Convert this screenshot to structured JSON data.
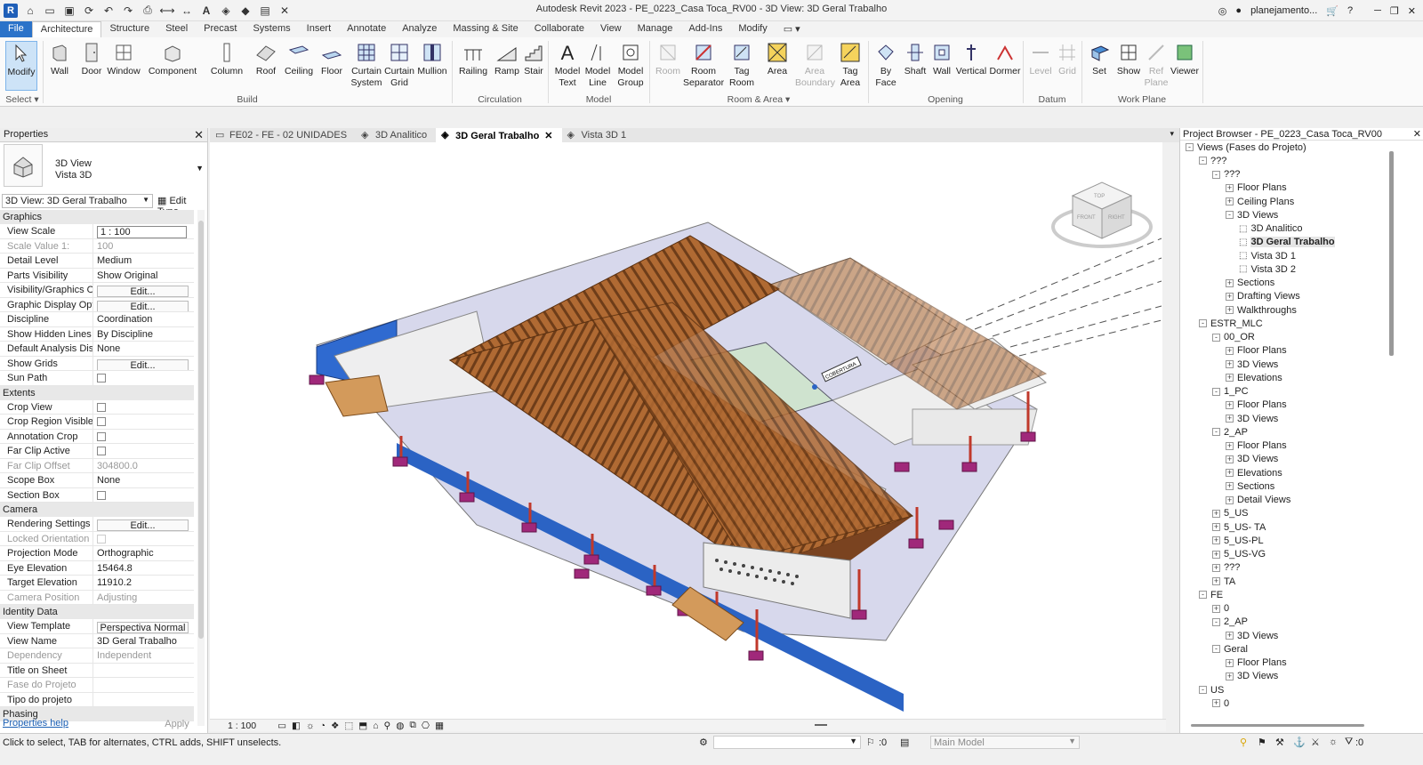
{
  "app": {
    "title": "Autodesk Revit 2023 - PE_0223_Casa Toca_RV00 - 3D View: 3D Geral Trabalho",
    "user": "planejamento...",
    "logo": "R"
  },
  "menu": [
    "File",
    "Architecture",
    "Structure",
    "Steel",
    "Precast",
    "Systems",
    "Insert",
    "Annotate",
    "Analyze",
    "Massing & Site",
    "Collaborate",
    "View",
    "Manage",
    "Add-Ins",
    "Modify"
  ],
  "ribbon": {
    "panels": [
      "Select",
      "Build",
      "Circulation",
      "Model",
      "Room & Area",
      "Opening",
      "Datum",
      "Work Plane"
    ],
    "select_label": "Select",
    "room_area_label": "Room & Area",
    "buttons": {
      "modify": "Modify",
      "wall": "Wall",
      "door": "Door",
      "window": "Window",
      "component": "Component",
      "column": "Column",
      "roof": "Roof",
      "ceiling": "Ceiling",
      "floor": "Floor",
      "curtain_system": "Curtain System",
      "curtain_grid": "Curtain Grid",
      "mullion": "Mullion",
      "railing": "Railing",
      "ramp": "Ramp",
      "stair": "Stair",
      "model_text": "Model Text",
      "model_line": "Model Line",
      "model_group": "Model Group",
      "room": "Room",
      "room_separator": "Room Separator",
      "tag_room": "Tag Room",
      "area": "Area",
      "area_boundary": "Area Boundary",
      "tag_area": "Tag Area",
      "by_face": "By Face",
      "shaft": "Shaft",
      "wall_op": "Wall",
      "vertical": "Vertical",
      "dormer": "Dormer",
      "level": "Level",
      "grid": "Grid",
      "set": "Set",
      "show": "Show",
      "ref_plane": "Ref Plane",
      "viewer": "Viewer"
    }
  },
  "properties": {
    "title": "Properties",
    "type_line1": "3D View",
    "type_line2": "Vista 3D",
    "selector": "3D View: 3D Geral Trabalho",
    "edit_type": "Edit Type",
    "groups": {
      "graphics": "Graphics",
      "extents": "Extents",
      "camera": "Camera",
      "identity": "Identity Data",
      "phasing": "Phasing"
    },
    "rows": {
      "view_scale": [
        "View Scale",
        "1 : 100"
      ],
      "scale_value": [
        "Scale Value    1:",
        "100"
      ],
      "detail_level": [
        "Detail Level",
        "Medium"
      ],
      "parts_visibility": [
        "Parts Visibility",
        "Show Original"
      ],
      "vis_graphics": [
        "Visibility/Graphics O...",
        "Edit..."
      ],
      "graphic_display": [
        "Graphic Display Opti...",
        "Edit..."
      ],
      "discipline": [
        "Discipline",
        "Coordination"
      ],
      "hidden_lines": [
        "Show Hidden Lines",
        "By Discipline"
      ],
      "analysis_display": [
        "Default Analysis Dis...",
        "None"
      ],
      "show_grids": [
        "Show Grids",
        "Edit..."
      ],
      "sun_path": [
        "Sun Path",
        ""
      ],
      "crop_view": [
        "Crop View",
        ""
      ],
      "crop_region": [
        "Crop Region Visible",
        ""
      ],
      "annotation_crop": [
        "Annotation Crop",
        ""
      ],
      "far_clip_active": [
        "Far Clip Active",
        ""
      ],
      "far_clip_offset": [
        "Far Clip Offset",
        "304800.0"
      ],
      "scope_box": [
        "Scope Box",
        "None"
      ],
      "section_box": [
        "Section Box",
        ""
      ],
      "rendering": [
        "Rendering Settings",
        "Edit..."
      ],
      "locked_orientation": [
        "Locked Orientation",
        ""
      ],
      "projection_mode": [
        "Projection Mode",
        "Orthographic"
      ],
      "eye_elevation": [
        "Eye Elevation",
        "15464.8"
      ],
      "target_elevation": [
        "Target Elevation",
        "11910.2"
      ],
      "camera_position": [
        "Camera Position",
        "Adjusting"
      ],
      "view_template": [
        "View Template",
        "Perspectiva Normal"
      ],
      "view_name": [
        "View Name",
        "3D Geral Trabalho"
      ],
      "dependency": [
        "Dependency",
        "Independent"
      ],
      "title_on_sheet": [
        "Title on Sheet",
        ""
      ],
      "fase_projeto": [
        "Fase do Projeto",
        ""
      ],
      "tipo_projeto": [
        "Tipo do projeto",
        ""
      ]
    },
    "help": "Properties help",
    "apply": "Apply"
  },
  "tabs": [
    "FE02 - FE - 02 UNIDADES",
    "3D Analitico",
    "3D Geral Trabalho",
    "Vista 3D 1"
  ],
  "viewcube": {
    "top": "TOP",
    "front": "FRONT",
    "right": "RIGHT"
  },
  "tag_label": "COBERTURA",
  "view_scale": "1 : 100",
  "browser": {
    "title": "Project Browser - PE_0223_Casa Toca_RV00",
    "nodes": [
      {
        "label": "Views (Fases do Projeto)",
        "lvl": 0,
        "tg": "-"
      },
      {
        "label": "???",
        "lvl": 1,
        "tg": "-"
      },
      {
        "label": "???",
        "lvl": 2,
        "tg": "-"
      },
      {
        "label": "Floor Plans",
        "lvl": 3,
        "tg": "+"
      },
      {
        "label": "Ceiling Plans",
        "lvl": 3,
        "tg": "+"
      },
      {
        "label": "3D Views",
        "lvl": 3,
        "tg": "-"
      },
      {
        "label": "3D Analitico",
        "lvl": 4,
        "tg": ""
      },
      {
        "label": "3D Geral Trabalho",
        "lvl": 4,
        "tg": "",
        "bold": true
      },
      {
        "label": "Vista 3D 1",
        "lvl": 4,
        "tg": ""
      },
      {
        "label": "Vista 3D 2",
        "lvl": 4,
        "tg": ""
      },
      {
        "label": "Sections",
        "lvl": 3,
        "tg": "+"
      },
      {
        "label": "Drafting Views",
        "lvl": 3,
        "tg": "+"
      },
      {
        "label": "Walkthroughs",
        "lvl": 3,
        "tg": "+"
      },
      {
        "label": "ESTR_MLC",
        "lvl": 1,
        "tg": "-"
      },
      {
        "label": "00_OR",
        "lvl": 2,
        "tg": "-"
      },
      {
        "label": "Floor Plans",
        "lvl": 3,
        "tg": "+"
      },
      {
        "label": "3D Views",
        "lvl": 3,
        "tg": "+"
      },
      {
        "label": "Elevations",
        "lvl": 3,
        "tg": "+"
      },
      {
        "label": "1_PC",
        "lvl": 2,
        "tg": "-"
      },
      {
        "label": "Floor Plans",
        "lvl": 3,
        "tg": "+"
      },
      {
        "label": "3D Views",
        "lvl": 3,
        "tg": "+"
      },
      {
        "label": "2_AP",
        "lvl": 2,
        "tg": "-"
      },
      {
        "label": "Floor Plans",
        "lvl": 3,
        "tg": "+"
      },
      {
        "label": "3D Views",
        "lvl": 3,
        "tg": "+"
      },
      {
        "label": "Elevations",
        "lvl": 3,
        "tg": "+"
      },
      {
        "label": "Sections",
        "lvl": 3,
        "tg": "+"
      },
      {
        "label": "Detail Views",
        "lvl": 3,
        "tg": "+"
      },
      {
        "label": "5_US",
        "lvl": 2,
        "tg": "+"
      },
      {
        "label": "5_US- TA",
        "lvl": 2,
        "tg": "+"
      },
      {
        "label": "5_US-PL",
        "lvl": 2,
        "tg": "+"
      },
      {
        "label": "5_US-VG",
        "lvl": 2,
        "tg": "+"
      },
      {
        "label": "???",
        "lvl": 2,
        "tg": "+"
      },
      {
        "label": "TA",
        "lvl": 2,
        "tg": "+"
      },
      {
        "label": "FE",
        "lvl": 1,
        "tg": "-"
      },
      {
        "label": "0",
        "lvl": 2,
        "tg": "+"
      },
      {
        "label": "2_AP",
        "lvl": 2,
        "tg": "-"
      },
      {
        "label": "3D Views",
        "lvl": 3,
        "tg": "+"
      },
      {
        "label": "Geral",
        "lvl": 2,
        "tg": "-"
      },
      {
        "label": "Floor Plans",
        "lvl": 3,
        "tg": "+"
      },
      {
        "label": "3D Views",
        "lvl": 3,
        "tg": "+"
      },
      {
        "label": "US",
        "lvl": 1,
        "tg": "-"
      },
      {
        "label": "0",
        "lvl": 2,
        "tg": "+"
      }
    ]
  },
  "status": {
    "hint": "Click to select, TAB for alternates, CTRL adds, SHIFT unselects.",
    "zero": ":0",
    "model": "Main Model",
    "filter": ":0"
  },
  "colors": {
    "accent": "#2b73c9",
    "wood": "#9a5a2a",
    "blue": "#1f5fd1",
    "magenta": "#b0287a"
  }
}
